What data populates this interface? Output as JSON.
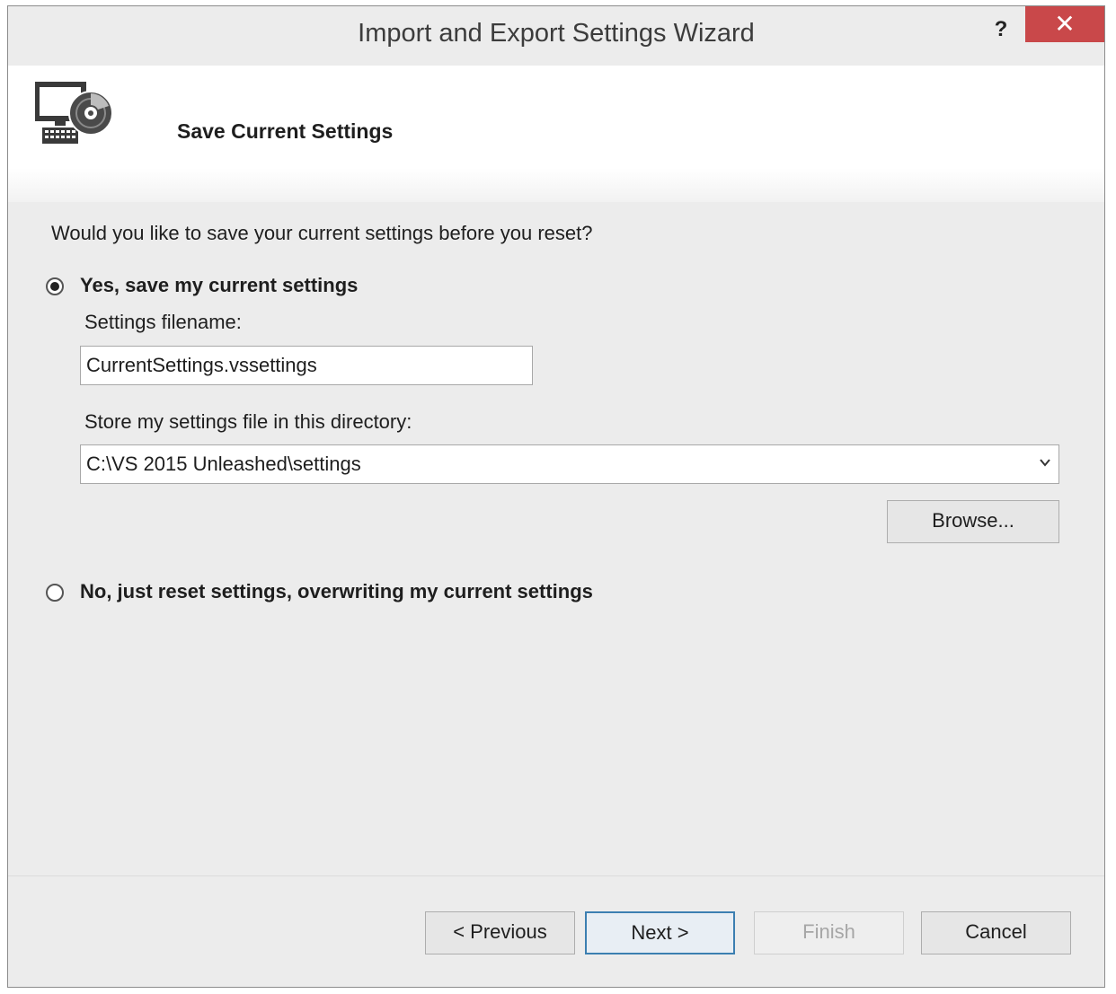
{
  "window": {
    "title": "Import and Export Settings Wizard",
    "help_label": "?",
    "close_label": "✕",
    "close_color": "#c9484a"
  },
  "header": {
    "icon": "computer-disc-icon",
    "title": "Save Current Settings"
  },
  "content": {
    "question": "Would you like to save your current settings before you reset?",
    "option_save": {
      "label": "Yes, save my current settings",
      "selected": true
    },
    "filename_label": "Settings filename:",
    "filename_value": "CurrentSettings.vssettings",
    "directory_label": "Store my settings file in this directory:",
    "directory_value": "C:\\VS 2015 Unleashed\\settings",
    "browse_label": "Browse...",
    "option_reset": {
      "label": "No, just reset settings, overwriting my current settings",
      "selected": false
    }
  },
  "footer": {
    "previous_label": "< Previous",
    "next_label": "Next >",
    "finish_label": "Finish",
    "cancel_label": "Cancel"
  }
}
